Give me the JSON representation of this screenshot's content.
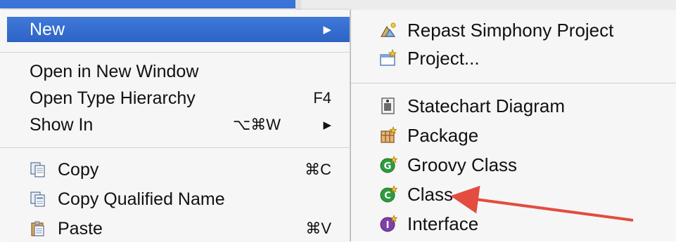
{
  "menu": {
    "items": [
      {
        "label": "New",
        "arrow": "▶"
      },
      {
        "label": "Open in New Window"
      },
      {
        "label": "Open Type Hierarchy",
        "shortcut": "F4"
      },
      {
        "label": "Show In",
        "shortcut": "⌥⌘W",
        "arrow": "▶"
      },
      {
        "label": "Copy",
        "shortcut": "⌘C",
        "icon": "copy-icon"
      },
      {
        "label": "Copy Qualified Name",
        "icon": "copy-qualified-name-icon"
      },
      {
        "label": "Paste",
        "shortcut": "⌘V",
        "icon": "paste-icon"
      }
    ]
  },
  "submenu": {
    "items": [
      {
        "label": "Repast Simphony Project",
        "icon": "repast-project-icon"
      },
      {
        "label": "Project...",
        "icon": "new-project-icon"
      },
      {
        "label": "Statechart Diagram",
        "icon": "statechart-icon"
      },
      {
        "label": "Package",
        "icon": "package-icon"
      },
      {
        "label": "Groovy Class",
        "icon": "groovy-class-icon"
      },
      {
        "label": "Class",
        "icon": "class-icon"
      },
      {
        "label": "Interface",
        "icon": "interface-icon"
      }
    ]
  },
  "colors": {
    "highlight": "#3a72d4",
    "annotation": "#e34c3f",
    "class_icon": "#2e9b3d",
    "interface_icon": "#7e3fa8"
  }
}
